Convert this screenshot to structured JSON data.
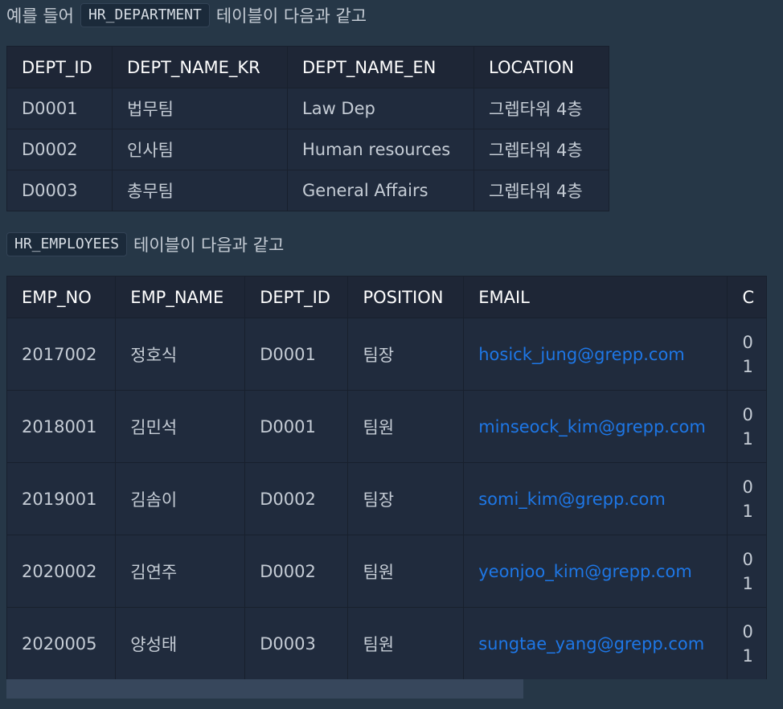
{
  "intro1": {
    "prefix": "예를 들어",
    "code": "HR_DEPARTMENT",
    "suffix": "테이블이 다음과 같고"
  },
  "department_table": {
    "headers": [
      "DEPT_ID",
      "DEPT_NAME_KR",
      "DEPT_NAME_EN",
      "LOCATION"
    ],
    "rows": [
      [
        "D0001",
        "법무팀",
        "Law Dep",
        "그렙타워 4층"
      ],
      [
        "D0002",
        "인사팀",
        "Human resources",
        "그렙타워 4층"
      ],
      [
        "D0003",
        "총무팀",
        "General Affairs",
        "그렙타워 4층"
      ]
    ]
  },
  "intro2": {
    "code": "HR_EMPLOYEES",
    "suffix": "테이블이 다음과 같고"
  },
  "employees_table": {
    "headers": [
      "EMP_NO",
      "EMP_NAME",
      "DEPT_ID",
      "POSITION",
      "EMAIL",
      "C"
    ],
    "rows": [
      [
        "2017002",
        "정호식",
        "D0001",
        "팀장",
        "hosick_jung@grepp.com",
        "0",
        "1"
      ],
      [
        "2018001",
        "김민석",
        "D0001",
        "팀원",
        "minseock_kim@grepp.com",
        "0",
        "1"
      ],
      [
        "2019001",
        "김솜이",
        "D0002",
        "팀장",
        "somi_kim@grepp.com",
        "0",
        "1"
      ],
      [
        "2020002",
        "김연주",
        "D0002",
        "팀원",
        "yeonjoo_kim@grepp.com",
        "0",
        "1"
      ],
      [
        "2020005",
        "양성태",
        "D0003",
        "팀원",
        "sungtae_yang@grepp.com",
        "0",
        "1"
      ]
    ]
  },
  "scrollbar": {
    "visible_fraction": 0.68,
    "position": 0
  }
}
